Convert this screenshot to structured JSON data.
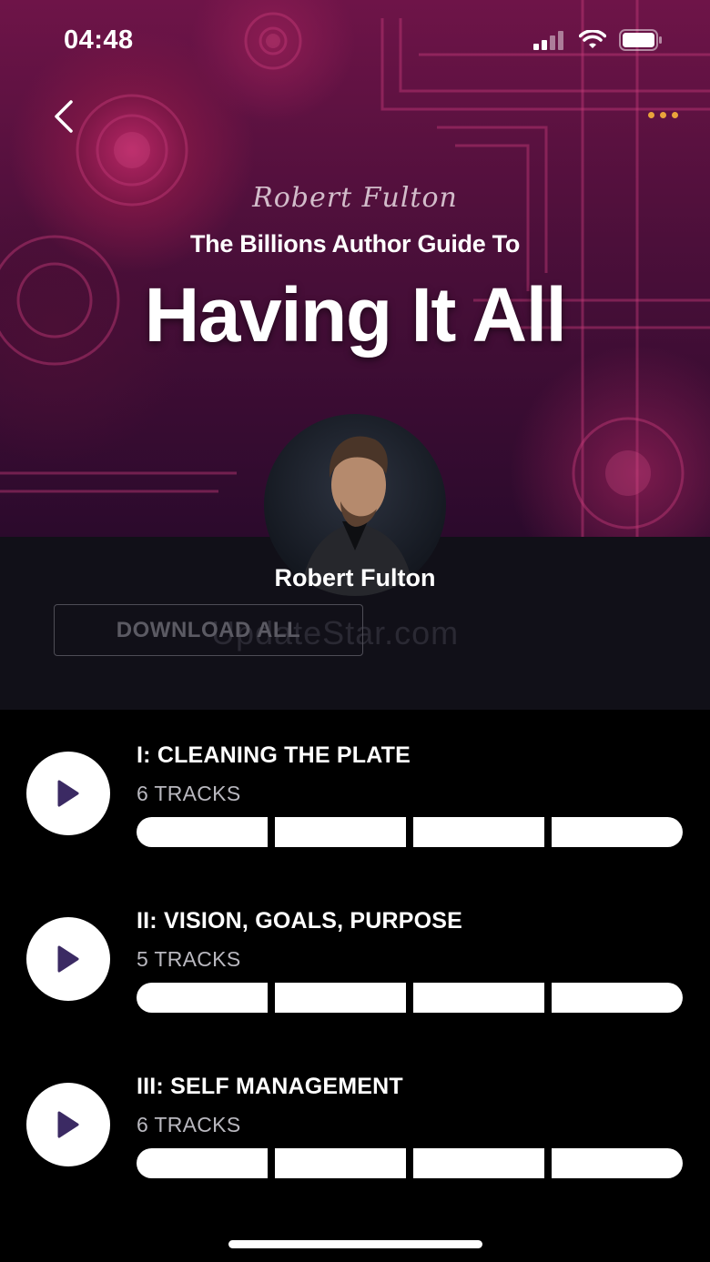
{
  "status_bar": {
    "time": "04:48",
    "icons": [
      "signal-icon",
      "wifi-icon",
      "battery-icon"
    ]
  },
  "nav": {
    "back_icon": "chevron-left-icon",
    "more_icon": "more-horizontal-icon",
    "more_color": "#e9a43b"
  },
  "hero": {
    "signature": "Robert Fulton",
    "subtitle": "The Billions Author Guide To",
    "title": "Having It All"
  },
  "author": {
    "name": "Robert Fulton"
  },
  "actions": {
    "download_all_label": "DOWNLOAD ALL"
  },
  "watermark": "UpdateStar.com",
  "modules": [
    {
      "title": "I: Cleaning the Plate",
      "tracks": "6 TRACKS",
      "segments": 4
    },
    {
      "title": "II: Vision, Goals, Purpose",
      "tracks": "5 TRACKS",
      "segments": 4
    },
    {
      "title": "III: Self Management",
      "tracks": "6 TRACKS",
      "segments": 4
    }
  ],
  "colors": {
    "accent_play": "#3b2a63",
    "background": "#000000",
    "panel": "#111018",
    "hero_tint": "#7a1645"
  }
}
